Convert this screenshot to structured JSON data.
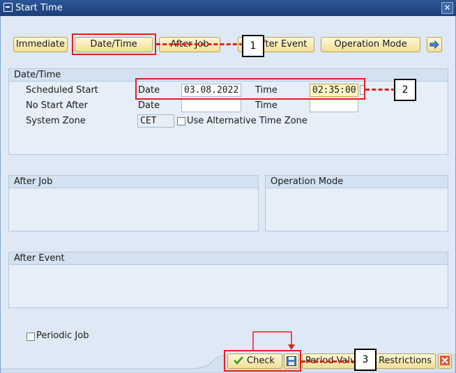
{
  "window": {
    "title": "Start Time"
  },
  "toolbar": {
    "immediate": "Immediate",
    "date_time": "Date/Time",
    "after_job": "After Job",
    "after_event": "After Event",
    "operation_mode": "Operation Mode"
  },
  "date_time_group": {
    "header": "Date/Time",
    "scheduled_start": "Scheduled Start",
    "no_start_after": "No Start After",
    "system_zone": "System Zone",
    "date_label": "Date",
    "time_label": "Time",
    "scheduled_date": "03.08.2022",
    "scheduled_time": "02:35:00",
    "no_start_date": "",
    "no_start_time": "",
    "zone_value": "CET",
    "alt_tz_label": "Use Alternative Time Zone"
  },
  "after_job_group": {
    "header": "After Job"
  },
  "operation_mode_group": {
    "header": "Operation Mode"
  },
  "after_event_group": {
    "header": "After Event"
  },
  "periodic_job_label": "Periodic Job",
  "footer": {
    "check": "Check",
    "period_values": "Period Values",
    "restrictions": "Restrictions"
  },
  "callouts": {
    "c1": "1",
    "c2": "2",
    "c3": "3"
  },
  "colors": {
    "highlight": "#e02020",
    "accent": "#1c3f7a"
  }
}
